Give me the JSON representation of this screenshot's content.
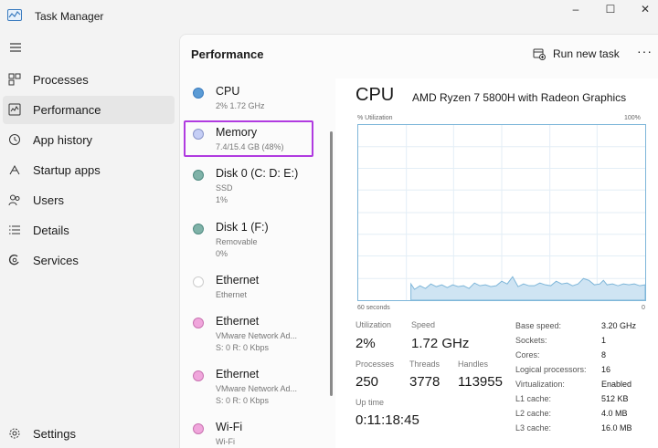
{
  "window": {
    "title": "Task Manager",
    "minimize": "–",
    "maximize": "☐",
    "close": "✕"
  },
  "nav": {
    "items": [
      {
        "label": "Processes",
        "icon": "processes-icon"
      },
      {
        "label": "Performance",
        "icon": "performance-icon",
        "active": true
      },
      {
        "label": "App history",
        "icon": "app-history-icon"
      },
      {
        "label": "Startup apps",
        "icon": "startup-apps-icon"
      },
      {
        "label": "Users",
        "icon": "users-icon"
      },
      {
        "label": "Details",
        "icon": "details-icon"
      },
      {
        "label": "Services",
        "icon": "services-icon"
      }
    ],
    "settings": "Settings"
  },
  "header": {
    "title": "Performance",
    "run_new_task": "Run new task",
    "more": "···"
  },
  "devices": [
    {
      "name": "CPU",
      "sub1": "2%  1.72 GHz",
      "sub2": "",
      "color": "#5b9bd5",
      "border": "#3a7bbf"
    },
    {
      "name": "Memory",
      "sub1": "7.4/15.4 GB (48%)",
      "sub2": "",
      "color": "#c5cef5",
      "border": "#8a95c9",
      "selected": true
    },
    {
      "name": "Disk 0 (C: D: E:)",
      "sub1": "SSD",
      "sub2": "1%",
      "color": "#7fb2a8",
      "border": "#4f8a80"
    },
    {
      "name": "Disk 1 (F:)",
      "sub1": "Removable",
      "sub2": "0%",
      "color": "#7fb2a8",
      "border": "#4f8a80"
    },
    {
      "name": "Ethernet",
      "sub1": "Ethernet",
      "sub2": "",
      "color": "#ffffff",
      "border": "#cccccc"
    },
    {
      "name": "Ethernet",
      "sub1": "VMware Network Ad...",
      "sub2": "S: 0 R: 0 Kbps",
      "color": "#f0a6dc",
      "border": "#c872b0"
    },
    {
      "name": "Ethernet",
      "sub1": "VMware Network Ad...",
      "sub2": "S: 0 R: 0 Kbps",
      "color": "#f0a6dc",
      "border": "#c872b0"
    },
    {
      "name": "Wi-Fi",
      "sub1": "Wi-Fi",
      "sub2": "",
      "color": "#f0a6dc",
      "border": "#c872b0"
    }
  ],
  "detail": {
    "title": "CPU",
    "model": "AMD Ryzen 7 5800H with Radeon Graphics",
    "util_label": "% Utilization",
    "max_label": "100%",
    "time_label": "60 seconds",
    "zero_label": "0",
    "graph_color": "#7eb6d9",
    "stats": {
      "utilization_label": "Utilization",
      "utilization_value": "2%",
      "speed_label": "Speed",
      "speed_value": "1.72 GHz",
      "processes_label": "Processes",
      "processes_value": "250",
      "threads_label": "Threads",
      "threads_value": "3778",
      "handles_label": "Handles",
      "handles_value": "113955",
      "uptime_label": "Up time",
      "uptime_value": "0:11:18:45"
    },
    "specs": [
      {
        "key": "Base speed:",
        "value": "3.20 GHz"
      },
      {
        "key": "Sockets:",
        "value": "1"
      },
      {
        "key": "Cores:",
        "value": "8"
      },
      {
        "key": "Logical processors:",
        "value": "16"
      },
      {
        "key": "Virtualization:",
        "value": "Enabled"
      },
      {
        "key": "L1 cache:",
        "value": "512 KB"
      },
      {
        "key": "L2 cache:",
        "value": "4.0 MB"
      },
      {
        "key": "L3 cache:",
        "value": "16.0 MB"
      }
    ]
  }
}
